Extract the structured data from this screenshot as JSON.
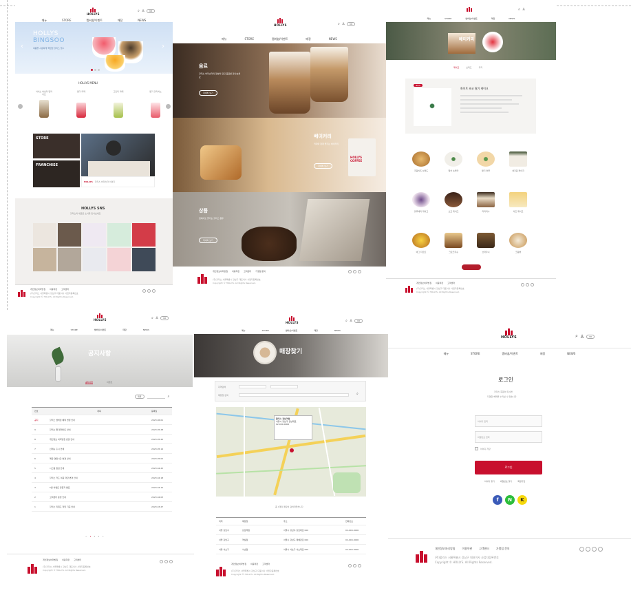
{
  "brand": {
    "logo_text": "HOLLYS",
    "accent": "#c8102e"
  },
  "header": {
    "nav": [
      "메뉴",
      "STORE",
      "멤버쉽/이벤트",
      "매장",
      "NEWS"
    ],
    "lang": "KR"
  },
  "main_page": {
    "banner_title_1": "HOLLYS",
    "banner_title_2": "BINGSOO",
    "banner_sub": "여름을 시원하게 책임질 할리스 빙수",
    "section_title": "HOLLYS MENU",
    "menu_items": [
      "아이스 바닐라 딜라이트",
      "딸기 라떼",
      "그린티 라떼",
      "딸기 할리치노"
    ],
    "store_label": "STORE",
    "franchise_label": "FRANCHISE",
    "video_caption": "할리스 바리스타 이야기",
    "sns_title": "HOLLYS SNS",
    "sns_sub": "할리스의 새로운 소식을 만나보세요"
  },
  "menu_page": {
    "categories": [
      {
        "title": "음료",
        "desc": "할리스 바리스타의 정성이 담긴 음료를 만나보세요",
        "btn": "자세히 보기"
      },
      {
        "title": "베이커리",
        "desc": "커피와 함께 즐기는 베이커리",
        "btn": "자세히 보기"
      },
      {
        "title": "상품",
        "desc": "집에서도 즐기는 할리스 원두",
        "btn": "자세히 보기"
      }
    ],
    "coffee_label": "HOLLYS COFFEE"
  },
  "bakery_page": {
    "hero_title": "베이커리",
    "tabs": [
      "케이크",
      "브레드",
      "쿠키"
    ],
    "badge": "NEW",
    "feature_name": "화이트 초코 딸기 케이크",
    "products": [
      "크림치즈 브레드",
      "말차 쇼콜라",
      "딸기 와플",
      "생크림 케이크",
      "블루베리 케이크",
      "초코 케이크",
      "티라미수",
      "치즈 케이크",
      "에그 타르트",
      "크로크무슈",
      "브라우니",
      "크림빵"
    ]
  },
  "notice_page": {
    "title": "공지사항",
    "subtabs": [
      "공지사항",
      "이벤트"
    ],
    "columns": [
      "번호",
      "제목",
      "등록일"
    ],
    "rows": [
      {
        "no": "공지",
        "title": "할리스 멤버쉽 혜택 변경 안내",
        "date": "2023.06.01"
      },
      {
        "no": "9",
        "title": "할리스 앱 업데이트 안내",
        "date": "2023.05.28"
      },
      {
        "no": "8",
        "title": "개인정보 처리방침 변경 안내",
        "date": "2023.05.20"
      },
      {
        "no": "7",
        "title": "신메뉴 출시 안내",
        "date": "2023.05.14"
      },
      {
        "no": "6",
        "title": "매장 영업시간 변경 안내",
        "date": "2023.05.02"
      },
      {
        "no": "5",
        "title": "시스템 점검 안내",
        "date": "2023.04.25"
      },
      {
        "no": "4",
        "title": "할리스 카드 이용 약관 변경 안내",
        "date": "2023.04.18"
      },
      {
        "no": "3",
        "title": "5월 이벤트 당첨자 발표",
        "date": "2023.04.10"
      },
      {
        "no": "2",
        "title": "고객센터 운영 안내",
        "date": "2023.04.03"
      },
      {
        "no": "1",
        "title": "할리스 리워드 적립 기준 안내",
        "date": "2023.03.27"
      }
    ],
    "pagination": [
      "<",
      "1",
      "2",
      "3",
      ">"
    ],
    "search_label": "제목"
  },
  "store_page": {
    "title": "매장찾기",
    "search_labels": [
      "지역검색",
      "매장명 검색"
    ],
    "map_popup_title": "할리스 강남역점",
    "map_popup_lines": [
      "서울시 강남구 강남대로",
      "02-000-0000"
    ],
    "result_text": "총 4개의 매장이 검색되었습니다",
    "columns": [
      "지역",
      "매장명",
      "주소",
      "전화번호"
    ],
    "rows": [
      {
        "region": "서울 강남구",
        "name": "강남역점",
        "addr": "서울시 강남구 강남대로 000",
        "tel": "02-000-0000"
      },
      {
        "region": "서울 강남구",
        "name": "역삼점",
        "addr": "서울시 강남구 테헤란로 000",
        "tel": "02-000-0000"
      },
      {
        "region": "서울 서초구",
        "name": "서초점",
        "addr": "서울시 서초구 서초대로 000",
        "tel": "02-000-0000"
      }
    ]
  },
  "login_page": {
    "title": "로그인",
    "desc_1": "할리스 회원이 되시면",
    "desc_2": "다양한 혜택을 누리실 수 있습니다",
    "id_placeholder": "아이디 입력",
    "pw_placeholder": "비밀번호 입력",
    "save_id": "아이디 저장",
    "login_btn": "로그인",
    "links": [
      "아이디 찾기",
      "비밀번호 찾기",
      "회원가입"
    ],
    "social": [
      "f",
      "N",
      "K"
    ]
  },
  "footer": {
    "links": [
      "개인정보처리방침",
      "이용약관",
      "고객센터",
      "가맹점 문의"
    ],
    "company_line": "(주)할리스 서울특별시 강남구 대표이사 사업자등록번호",
    "copyright": "Copyright © HOLLYS. All Rights Reserved."
  }
}
